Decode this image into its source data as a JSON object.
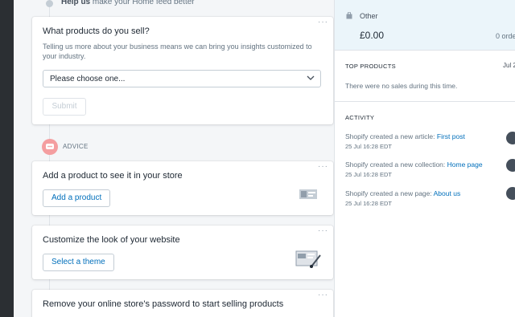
{
  "help": {
    "bold": "Help us",
    "rest": " make your Home feed better"
  },
  "survey": {
    "title": "What products do you sell?",
    "description": "Telling us more about your business means we can bring you insights customized to your industry.",
    "select_value": "Please choose one...",
    "submit_label": "Submit",
    "menu_dots": "···"
  },
  "advice": {
    "label": "ADVICE"
  },
  "cards": [
    {
      "title": "Add a product to see it in your store",
      "button": "Add a product",
      "menu_dots": "···"
    },
    {
      "title": "Customize the look of your website",
      "button": "Select a theme",
      "menu_dots": "···"
    },
    {
      "title": "Remove your online store's password to start selling products",
      "menu_dots": "···"
    }
  ],
  "sidebar": {
    "other_label": "Other",
    "other_amount": "£0.00",
    "other_orders": "0 orde",
    "top_products_title": "TOP PRODUCTS",
    "top_products_date": "Jul 2",
    "no_sales": "There were no sales during this time.",
    "activity_title": "ACTIVITY",
    "activity": [
      {
        "text": "Shopify created a new article: ",
        "link": "First post",
        "time": "25 Jul 16:28 EDT"
      },
      {
        "text": "Shopify created a new collection: ",
        "link": "Home page",
        "time": "25 Jul 16:28 EDT"
      },
      {
        "text": "Shopify created a new page: ",
        "link": "About us",
        "time": "25 Jul 16:28 EDT"
      }
    ]
  },
  "colors": {
    "accent": "#006fbb",
    "advice_badge": "#f49ea0",
    "highlight_bg": "#ebf5fa",
    "sidebar_dark": "#2b2f33"
  }
}
